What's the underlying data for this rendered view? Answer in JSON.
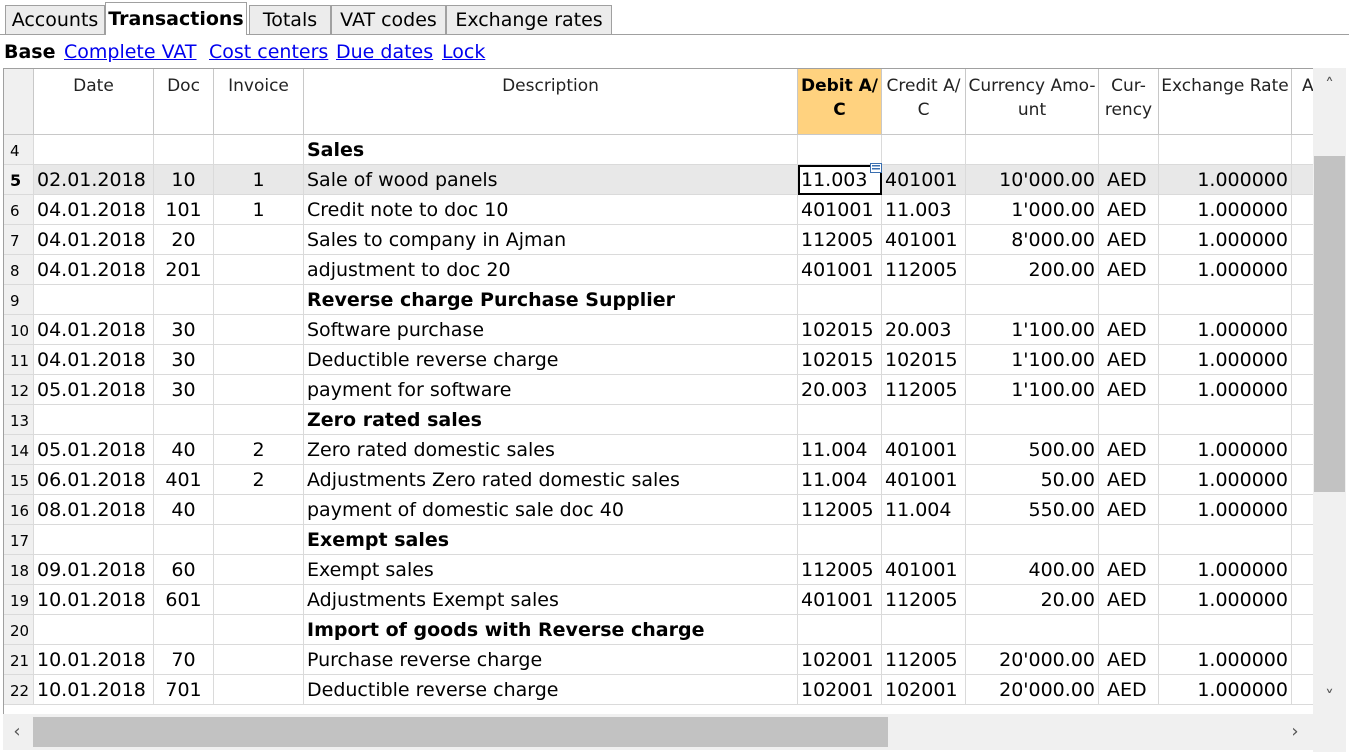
{
  "tabs": [
    {
      "label": "Accounts"
    },
    {
      "label": "Transactions"
    },
    {
      "label": "Totals"
    },
    {
      "label": "VAT codes"
    },
    {
      "label": "Exchange rates"
    }
  ],
  "views": {
    "current": "Base",
    "links": [
      "Complete VAT",
      "Cost centers",
      "Due dates",
      "Lock"
    ]
  },
  "columns": {
    "date": "Date",
    "doc": "Doc",
    "invoice": "Invoice",
    "description": "Description",
    "debit_line1": "Debit A/",
    "debit_line2": "C",
    "credit_line1": "Credit A/",
    "credit_line2": "C",
    "amount_line1": "Currency Amo-",
    "amount_line2": "unt",
    "currency_line1": "Cur-",
    "currency_line2": "rency",
    "rate": "Exchange Rate",
    "next_partial": "A"
  },
  "rows": [
    {
      "n": "4",
      "date": "",
      "doc": "",
      "inv": "",
      "desc": "Sales",
      "deb": "",
      "cre": "",
      "amt": "",
      "cur": "",
      "rate": ""
    },
    {
      "n": "5",
      "date": "02.01.2018",
      "doc": "10",
      "inv": "1",
      "desc": "Sale of wood panels",
      "deb": "11.003",
      "cre": "401001",
      "amt": "10'000.00",
      "cur": "AED",
      "rate": "1.000000"
    },
    {
      "n": "6",
      "date": "04.01.2018",
      "doc": "101",
      "inv": "1",
      "desc": "Credit note to doc 10",
      "deb": "401001",
      "cre": "11.003",
      "amt": "1'000.00",
      "cur": "AED",
      "rate": "1.000000"
    },
    {
      "n": "7",
      "date": "04.01.2018",
      "doc": "20",
      "inv": "",
      "desc": "Sales to company in Ajman",
      "deb": "112005",
      "cre": "401001",
      "amt": "8'000.00",
      "cur": "AED",
      "rate": "1.000000"
    },
    {
      "n": "8",
      "date": "04.01.2018",
      "doc": "201",
      "inv": "",
      "desc": "adjustment to doc 20",
      "deb": "401001",
      "cre": "112005",
      "amt": "200.00",
      "cur": "AED",
      "rate": "1.000000"
    },
    {
      "n": "9",
      "date": "",
      "doc": "",
      "inv": "",
      "desc": "Reverse charge Purchase Supplier",
      "deb": "",
      "cre": "",
      "amt": "",
      "cur": "",
      "rate": ""
    },
    {
      "n": "10",
      "date": "04.01.2018",
      "doc": "30",
      "inv": "",
      "desc": "Software purchase",
      "deb": "102015",
      "cre": "20.003",
      "amt": "1'100.00",
      "cur": "AED",
      "rate": "1.000000"
    },
    {
      "n": "11",
      "date": "04.01.2018",
      "doc": "30",
      "inv": "",
      "desc": "Deductible reverse charge",
      "deb": "102015",
      "cre": "102015",
      "amt": "1'100.00",
      "cur": "AED",
      "rate": "1.000000"
    },
    {
      "n": "12",
      "date": "05.01.2018",
      "doc": "30",
      "inv": "",
      "desc": "payment for software",
      "deb": "20.003",
      "cre": "112005",
      "amt": "1'100.00",
      "cur": "AED",
      "rate": "1.000000"
    },
    {
      "n": "13",
      "date": "",
      "doc": "",
      "inv": "",
      "desc": "Zero rated sales",
      "deb": "",
      "cre": "",
      "amt": "",
      "cur": "",
      "rate": ""
    },
    {
      "n": "14",
      "date": "05.01.2018",
      "doc": "40",
      "inv": "2",
      "desc": "Zero rated domestic sales",
      "deb": "11.004",
      "cre": "401001",
      "amt": "500.00",
      "cur": "AED",
      "rate": "1.000000"
    },
    {
      "n": "15",
      "date": "06.01.2018",
      "doc": "401",
      "inv": "2",
      "desc": "Adjustments Zero rated domestic sales",
      "deb": "11.004",
      "cre": "401001",
      "amt": "50.00",
      "cur": "AED",
      "rate": "1.000000"
    },
    {
      "n": "16",
      "date": "08.01.2018",
      "doc": "40",
      "inv": "",
      "desc": "payment of domestic sale doc 40",
      "deb": "112005",
      "cre": "11.004",
      "amt": "550.00",
      "cur": "AED",
      "rate": "1.000000"
    },
    {
      "n": "17",
      "date": "",
      "doc": "",
      "inv": "",
      "desc": "Exempt sales",
      "deb": "",
      "cre": "",
      "amt": "",
      "cur": "",
      "rate": ""
    },
    {
      "n": "18",
      "date": "09.01.2018",
      "doc": "60",
      "inv": "",
      "desc": "Exempt sales",
      "deb": "112005",
      "cre": "401001",
      "amt": "400.00",
      "cur": "AED",
      "rate": "1.000000"
    },
    {
      "n": "19",
      "date": "10.01.2018",
      "doc": "601",
      "inv": "",
      "desc": "Adjustments Exempt sales",
      "deb": "401001",
      "cre": "112005",
      "amt": "20.00",
      "cur": "AED",
      "rate": "1.000000"
    },
    {
      "n": "20",
      "date": "",
      "doc": "",
      "inv": "",
      "desc": "Import of goods with Reverse charge",
      "deb": "",
      "cre": "",
      "amt": "",
      "cur": "",
      "rate": ""
    },
    {
      "n": "21",
      "date": "10.01.2018",
      "doc": "70",
      "inv": "",
      "desc": "Purchase reverse charge",
      "deb": "102001",
      "cre": "112005",
      "amt": "20'000.00",
      "cur": "AED",
      "rate": "1.000000"
    },
    {
      "n": "22",
      "date": "10.01.2018",
      "doc": "701",
      "inv": "",
      "desc": "Deductible reverse charge",
      "deb": "102001",
      "cre": "102001",
      "amt": "20'000.00",
      "cur": "AED",
      "rate": "1.000000"
    }
  ],
  "current_row": "5",
  "colors": {
    "selected_column": "#ffd27f",
    "link": "#0000ee"
  }
}
